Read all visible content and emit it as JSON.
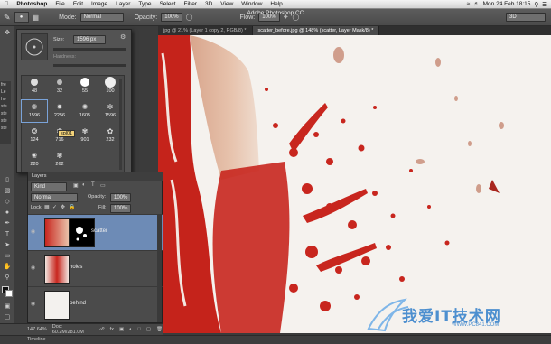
{
  "menubar": {
    "app": "Photoshop",
    "items": [
      "File",
      "Edit",
      "Image",
      "Layer",
      "Type",
      "Select",
      "Filter",
      "3D",
      "View",
      "Window",
      "Help"
    ],
    "clock": "Mon 24 Feb 18:15"
  },
  "window_title": "Adobe Photoshop CC",
  "options_bar": {
    "mode_label": "Mode:",
    "mode_value": "Normal",
    "opacity_label": "Opacity:",
    "opacity_value": "100%",
    "flow_label": "Flow:",
    "flow_value": "100%",
    "workspace": "3D"
  },
  "tabs": [
    {
      "label": "jpg @ 21% (Layer 1 copy 2, RGB/8) *",
      "active": false
    },
    {
      "label": "scatter_before.jpg @ 148% (scatter, Layer Mask/8) *",
      "active": true
    }
  ],
  "left_panel_text": [
    "fre",
    "Le",
    "ho",
    "ste",
    "ste",
    "ste",
    "ste"
  ],
  "brush_panel": {
    "size_label": "Size:",
    "size_value": "1596 px",
    "hardness_label": "Hardness:",
    "tooltip": "spl01",
    "brushes": [
      "48",
      "32",
      "55",
      "100",
      "1596",
      "2256",
      "1605",
      "1596",
      "124",
      "716",
      "901",
      "232",
      "220",
      "262"
    ]
  },
  "layers_panel": {
    "tab": "Layers",
    "kind": "Kind",
    "blend": "Normal",
    "opacity_label": "Opacity:",
    "opacity_value": "100%",
    "lock_label": "Lock:",
    "fill_label": "Fill:",
    "fill_value": "100%",
    "layers": [
      {
        "name": "scatter",
        "selected": true
      },
      {
        "name": "holes",
        "selected": false
      },
      {
        "name": "behind",
        "selected": false
      }
    ]
  },
  "status": {
    "zoom": "147.64%",
    "doc": "Doc: 60.2M/281.0M"
  },
  "timeline": "Timeline",
  "watermark": {
    "text": "我爱IT技术网",
    "url": "WWW.PC841.COM"
  },
  "colors": {
    "accent": "#6d8bb6",
    "splash_red": "#c8261e"
  }
}
